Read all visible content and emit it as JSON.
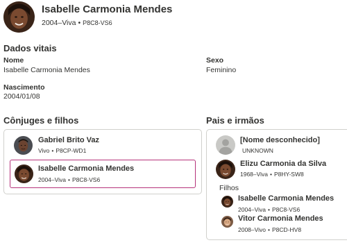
{
  "header": {
    "name": "Isabelle Carmonia Mendes",
    "lifespan": "2004–Viva",
    "pid": "P8C8-VS6"
  },
  "vitals": {
    "title": "Dados vitais",
    "name_label": "Nome",
    "name_value": "Isabelle Carmonia Mendes",
    "sex_label": "Sexo",
    "sex_value": "Feminino",
    "birth_label": "Nascimento",
    "birth_value": "2004/01/08"
  },
  "spouses": {
    "title": "Cônjuges e filhos",
    "people": [
      {
        "name": "Gabriel Brito Vaz",
        "lifespan": "Vivo",
        "pid": "P8CP-WD1"
      },
      {
        "name": "Isabelle Carmonia Mendes",
        "lifespan": "2004–Viva",
        "pid": "P8C8-VS6"
      }
    ]
  },
  "parents": {
    "title": "Pais e irmãos",
    "people": [
      {
        "name": "[Nome desconhecido]",
        "lifespan": "UNKNOWN"
      },
      {
        "name": "Elizu Carmonia da Silva",
        "lifespan": "1968–Viva",
        "pid": "P8HY-SW8"
      }
    ],
    "children_label": "Filhos",
    "children": [
      {
        "name": "Isabelle Carmonia Mendes",
        "lifespan": "2004–Viva",
        "pid": "P8C8-VS6"
      },
      {
        "name": "Vitor Carmonia Mendes",
        "lifespan": "2008–Vivo",
        "pid": "P8CD-HV8"
      }
    ]
  },
  "colors": {
    "selected_border": "#b5327a",
    "card_border": "#d0d0cc",
    "text": "#333331"
  }
}
